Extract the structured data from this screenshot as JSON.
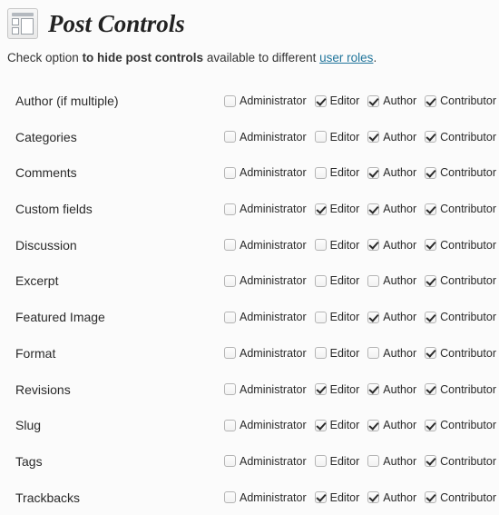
{
  "header": {
    "icon": "post-controls-window-icon",
    "title": "Post Controls"
  },
  "description": {
    "prefix": "Check option ",
    "bold": "to hide post controls",
    "middle": " available to different ",
    "link": "user roles",
    "suffix": ".",
    "link_color": "#21759b"
  },
  "roles": [
    "Administrator",
    "Editor",
    "Author",
    "Contributor"
  ],
  "rows": [
    {
      "label": "Author (if multiple)",
      "checked": [
        false,
        true,
        true,
        true
      ]
    },
    {
      "label": "Categories",
      "checked": [
        false,
        false,
        true,
        true
      ]
    },
    {
      "label": "Comments",
      "checked": [
        false,
        false,
        true,
        true
      ]
    },
    {
      "label": "Custom fields",
      "checked": [
        false,
        true,
        true,
        true
      ]
    },
    {
      "label": "Discussion",
      "checked": [
        false,
        false,
        true,
        true
      ]
    },
    {
      "label": "Excerpt",
      "checked": [
        false,
        false,
        false,
        true
      ]
    },
    {
      "label": "Featured Image",
      "checked": [
        false,
        false,
        true,
        true
      ]
    },
    {
      "label": "Format",
      "checked": [
        false,
        false,
        false,
        true
      ]
    },
    {
      "label": "Revisions",
      "checked": [
        false,
        true,
        true,
        true
      ]
    },
    {
      "label": "Slug",
      "checked": [
        false,
        true,
        true,
        true
      ]
    },
    {
      "label": "Tags",
      "checked": [
        false,
        false,
        false,
        true
      ]
    },
    {
      "label": "Trackbacks",
      "checked": [
        false,
        true,
        true,
        true
      ]
    }
  ]
}
